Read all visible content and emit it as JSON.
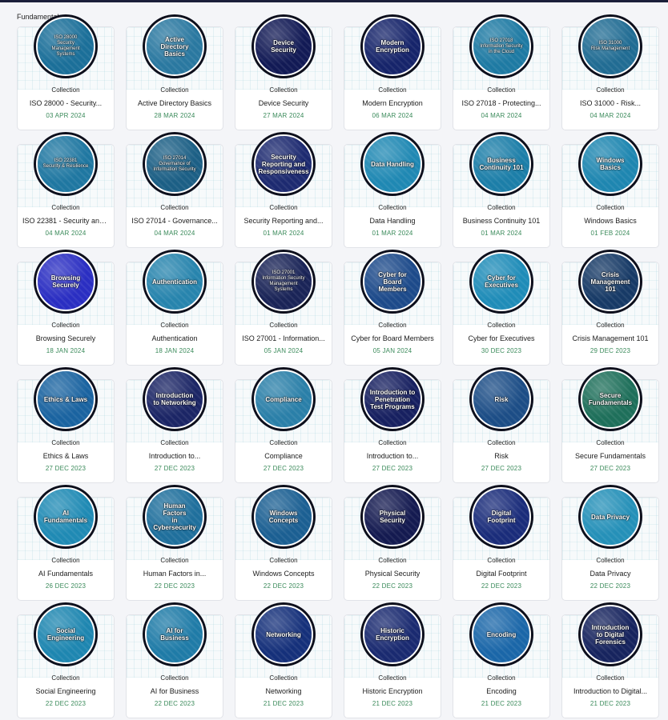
{
  "section_title": "Fundamentals",
  "kind_label": "Collection",
  "cards": [
    {
      "badge": "ISO 28000\nSecurity Management Systems",
      "small": true,
      "title": "ISO 28000 - Security...",
      "date": "03 APR 2024",
      "color": "#1b6f99"
    },
    {
      "badge": "Active Directory\nBasics",
      "small": false,
      "title": "Active Directory Basics",
      "date": "28 MAR 2024",
      "color": "#2a78a0"
    },
    {
      "badge": "Device\nSecurity",
      "small": false,
      "title": "Device Security",
      "date": "27 MAR 2024",
      "color": "#121a55"
    },
    {
      "badge": "Modern\nEncryption",
      "small": false,
      "title": "Modern Encryption",
      "date": "06 MAR 2024",
      "color": "#16246a"
    },
    {
      "badge": "ISO 27018\nInformation Security in the Cloud",
      "small": true,
      "title": "ISO 27018 - Protecting...",
      "date": "04 MAR 2024",
      "color": "#1e7aa3"
    },
    {
      "badge": "ISO 31000\nRisk Management",
      "small": true,
      "title": "ISO 31000 - Risk...",
      "date": "04 MAR 2024",
      "color": "#216c93"
    },
    {
      "badge": "ISO 22381\nSecurity & Resilience",
      "small": true,
      "title": "ISO 22381 - Security and...",
      "date": "04 MAR 2024",
      "color": "#1f77a1"
    },
    {
      "badge": "ISO 27014\nGovernance of Information Security",
      "small": true,
      "title": "ISO 27014 - Governance...",
      "date": "04 MAR 2024",
      "color": "#1c5f85"
    },
    {
      "badge": "Security\nReporting and\nResponsiveness",
      "small": false,
      "title": "Security Reporting and...",
      "date": "01 MAR 2024",
      "color": "#1d2a70"
    },
    {
      "badge": "Data Handling",
      "small": false,
      "title": "Data Handling",
      "date": "01 MAR 2024",
      "color": "#1f88b3"
    },
    {
      "badge": "Business\nContinuity 101",
      "small": false,
      "title": "Business Continuity 101",
      "date": "01 MAR 2024",
      "color": "#1c7ea8"
    },
    {
      "badge": "Windows Basics",
      "small": false,
      "title": "Windows Basics",
      "date": "01 FEB 2024",
      "color": "#1e86b0"
    },
    {
      "badge": "Browsing\nSecurely",
      "small": false,
      "title": "Browsing Securely",
      "date": "18 JAN 2024",
      "color": "#2a2ec2"
    },
    {
      "badge": "Authentication",
      "small": false,
      "title": "Authentication",
      "date": "18 JAN 2024",
      "color": "#2784ad"
    },
    {
      "badge": "ISO 27001\nInformation Security Management Systems",
      "small": true,
      "title": "ISO 27001 - Information...",
      "date": "05 JAN 2024",
      "color": "#1a2457"
    },
    {
      "badge": "Cyber for Board\nMembers",
      "small": false,
      "title": "Cyber for Board Members",
      "date": "05 JAN 2024",
      "color": "#1d4a8a"
    },
    {
      "badge": "Cyber for\nExecutives",
      "small": false,
      "title": "Cyber for Executives",
      "date": "30 DEC 2023",
      "color": "#1f8cb8"
    },
    {
      "badge": "Crisis\nManagement 101",
      "small": false,
      "title": "Crisis Management 101",
      "date": "29 DEC 2023",
      "color": "#173a66"
    },
    {
      "badge": "Ethics & Laws",
      "small": false,
      "title": "Ethics & Laws",
      "date": "27 DEC 2023",
      "color": "#1a63a0"
    },
    {
      "badge": "Introduction\nto Networking",
      "small": false,
      "title": "Introduction to...",
      "date": "27 DEC 2023",
      "color": "#1b2565"
    },
    {
      "badge": "Compliance",
      "small": false,
      "title": "Compliance",
      "date": "27 DEC 2023",
      "color": "#2a7fa8"
    },
    {
      "badge": "Introduction to\nPenetration\nTest Programs",
      "small": false,
      "title": "Introduction to...",
      "date": "27 DEC 2023",
      "color": "#172060"
    },
    {
      "badge": "Risk",
      "small": false,
      "title": "Risk",
      "date": "27 DEC 2023",
      "color": "#1c4d86"
    },
    {
      "badge": "Secure\nFundamentals",
      "small": false,
      "title": "Secure Fundamentals",
      "date": "27 DEC 2023",
      "color": "#1e6f5a"
    },
    {
      "badge": "AI Fundamentals",
      "small": false,
      "title": "AI Fundamentals",
      "date": "26 DEC 2023",
      "color": "#1f8ab4"
    },
    {
      "badge": "Human Factors\nin Cybersecurity",
      "small": false,
      "title": "Human Factors in...",
      "date": "22 DEC 2023",
      "color": "#1f6f9c"
    },
    {
      "badge": "Windows\nConcepts",
      "small": false,
      "title": "Windows Concepts",
      "date": "22 DEC 2023",
      "color": "#1b5f92"
    },
    {
      "badge": "Physical\nSecurity",
      "small": false,
      "title": "Physical Security",
      "date": "22 DEC 2023",
      "color": "#141a50"
    },
    {
      "badge": "Digital\nFootprint",
      "small": false,
      "title": "Digital Footprint",
      "date": "22 DEC 2023",
      "color": "#1a2c7a"
    },
    {
      "badge": "Data Privacy",
      "small": false,
      "title": "Data Privacy",
      "date": "22 DEC 2023",
      "color": "#2590b8"
    },
    {
      "badge": "Social\nEngineering",
      "small": false,
      "title": "Social Engineering",
      "date": "22 DEC 2023",
      "color": "#1e86b0"
    },
    {
      "badge": "AI for Business",
      "small": false,
      "title": "AI for Business",
      "date": "22 DEC 2023",
      "color": "#1f7ba7"
    },
    {
      "badge": "Networking",
      "small": false,
      "title": "Networking",
      "date": "21 DEC 2023",
      "color": "#15307a"
    },
    {
      "badge": "Historic\nEncryption",
      "small": false,
      "title": "Historic Encryption",
      "date": "21 DEC 2023",
      "color": "#1a2a70"
    },
    {
      "badge": "Encoding",
      "small": false,
      "title": "Encoding",
      "date": "21 DEC 2023",
      "color": "#1a66a8"
    },
    {
      "badge": "Introduction\nto Digital\nForensics",
      "small": false,
      "title": "Introduction to Digital...",
      "date": "21 DEC 2023",
      "color": "#17245e"
    }
  ]
}
